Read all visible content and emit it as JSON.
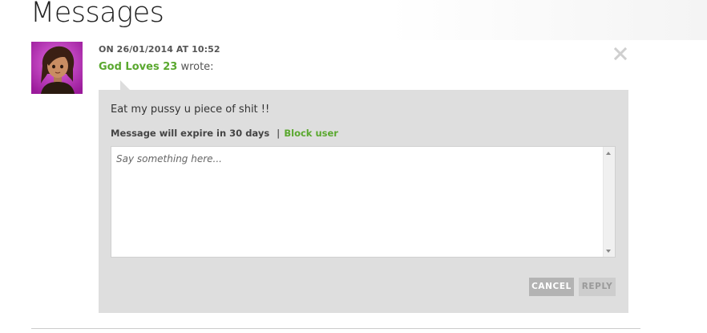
{
  "page": {
    "title": "Messages"
  },
  "message": {
    "date": "ON 26/01/2014 AT 10:52",
    "author": "God Loves 23",
    "wrote_suffix": "wrote:",
    "body": "Eat my pussy u piece of shit !!",
    "expiry": "Message will expire in 30 days",
    "separator": "|",
    "block_label": "Block user",
    "avatar_icon": "user-avatar-icon",
    "close_icon": "close-icon"
  },
  "reply": {
    "placeholder": "Say something here...",
    "cancel_label": "CANCEL",
    "reply_label": "REPLY"
  },
  "colors": {
    "accent_green": "#5aa82f",
    "panel_gray": "#dedede",
    "cancel_bg": "#b3b3b3",
    "reply_bg_disabled": "#cdcdcd"
  }
}
